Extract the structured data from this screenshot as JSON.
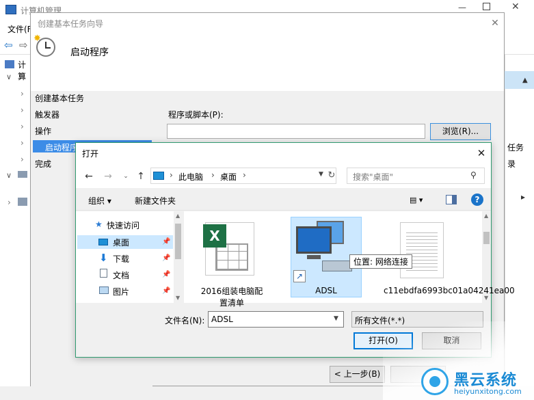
{
  "computer_management": {
    "title": "计算机管理",
    "menu_file": "文件(F",
    "tree_item": "计算",
    "right_labels": [
      "任务",
      "录"
    ]
  },
  "wizard": {
    "title": "创建基本任务向导",
    "heading": "启动程序",
    "steps": [
      "创建基本任务",
      "触发器",
      "操作",
      "启动程序",
      "完成"
    ],
    "selected_step": "启动程序",
    "program_label": "程序或脚本(P):",
    "program_value": "",
    "browse_label": "浏览(R)...",
    "back_label": "< 上一步(B)"
  },
  "open_dialog": {
    "title": "打开",
    "address": {
      "segments": [
        "此电脑",
        "桌面"
      ]
    },
    "search_placeholder": "搜索\"桌面\"",
    "organize_label": "组织 ▾",
    "new_folder_label": "新建文件夹",
    "nav_tree": [
      {
        "label": "快速访问",
        "icon": "star-icon"
      },
      {
        "label": "桌面",
        "icon": "desktop-icon",
        "selected": true
      },
      {
        "label": "下载",
        "icon": "download-icon"
      },
      {
        "label": "文档",
        "icon": "document-icon"
      },
      {
        "label": "图片",
        "icon": "picture-icon"
      }
    ],
    "files": [
      {
        "name": "2016组装电脑配置清单",
        "type": "excel"
      },
      {
        "name": "ADSL",
        "type": "shortcut",
        "selected": true
      },
      {
        "name": "c11ebdfa6993bc01a04241ea00",
        "type": "text"
      }
    ],
    "tooltip": "位置: 网络连接",
    "filename_label": "文件名(N):",
    "filename_value": "ADSL",
    "filetype_value": "所有文件(*.*)",
    "open_label": "打开(O)",
    "cancel_label": "取消"
  },
  "watermark": {
    "brand": "黑云系统",
    "url": "heiyunxitong.com"
  },
  "colors": {
    "accent": "#0078d7",
    "selection": "#cce8ff",
    "wizard_step_selected": "#3c8ce7",
    "dialog_border": "#2f9a6f"
  }
}
